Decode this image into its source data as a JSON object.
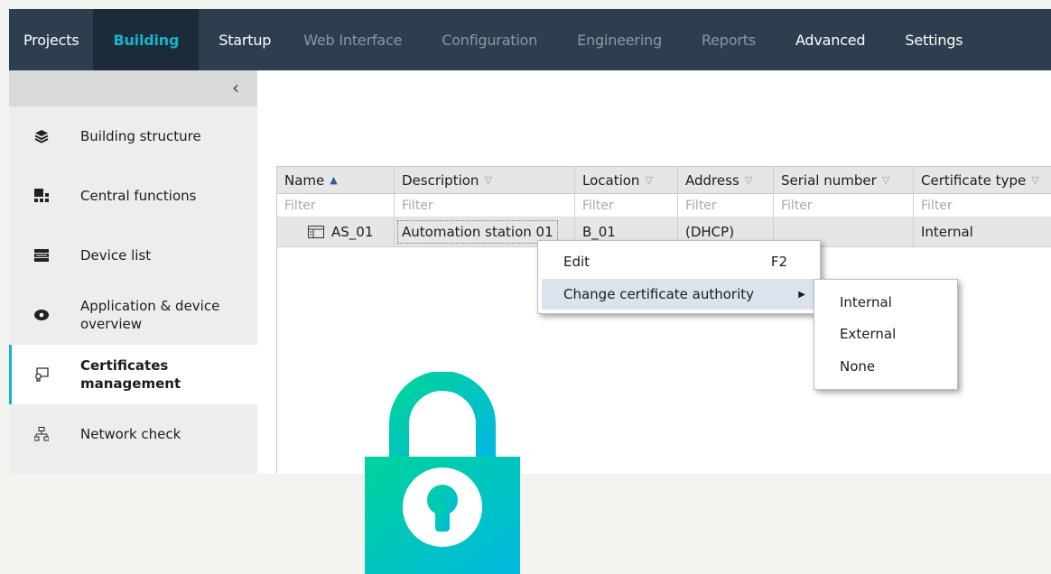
{
  "nav": {
    "tabs": [
      {
        "label": "Projects",
        "state": "bright"
      },
      {
        "label": "Building",
        "state": "active"
      },
      {
        "label": "Startup",
        "state": "bright"
      },
      {
        "label": "Web Interface",
        "state": "dim"
      },
      {
        "label": "Configuration",
        "state": "dim"
      },
      {
        "label": "Engineering",
        "state": "dim"
      },
      {
        "label": "Reports",
        "state": "dim"
      },
      {
        "label": "Advanced",
        "state": "bright"
      },
      {
        "label": "Settings",
        "state": "bright"
      }
    ]
  },
  "sidebar": {
    "collapse_icon": "‹",
    "items": [
      {
        "label": "Building structure",
        "icon": "layers-icon"
      },
      {
        "label": "Central functions",
        "icon": "central-functions-icon"
      },
      {
        "label": "Device list",
        "icon": "device-list-icon"
      },
      {
        "label": "Application & device overview",
        "icon": "eye-icon"
      },
      {
        "label": "Certificates management",
        "icon": "certificate-icon",
        "selected": true
      },
      {
        "label": "Network check",
        "icon": "network-icon"
      }
    ]
  },
  "grid": {
    "columns": [
      {
        "label": "Name",
        "sort": "asc"
      },
      {
        "label": "Description",
        "sort": "none"
      },
      {
        "label": "Location",
        "sort": "none"
      },
      {
        "label": "Address",
        "sort": "none"
      },
      {
        "label": "Serial number",
        "sort": "none"
      },
      {
        "label": "Certificate type",
        "sort": "none"
      }
    ],
    "filter_placeholder": "Filter",
    "rows": [
      {
        "name": "AS_01",
        "description": "Automation station 01",
        "location": "B_01",
        "address": "(DHCP)",
        "serial": "",
        "certificate_type": "Internal"
      }
    ]
  },
  "context_menu": {
    "items": [
      {
        "label": "Edit",
        "shortcut": "F2"
      },
      {
        "label": "Change certificate authority",
        "submenu": true
      }
    ],
    "submenu": [
      "Internal",
      "External",
      "None"
    ]
  },
  "colors": {
    "nav_bg": "#2d3e4f",
    "accent": "#14b3ce",
    "lock_gradient_start": "#00d39b",
    "lock_gradient_end": "#00b8e0"
  }
}
